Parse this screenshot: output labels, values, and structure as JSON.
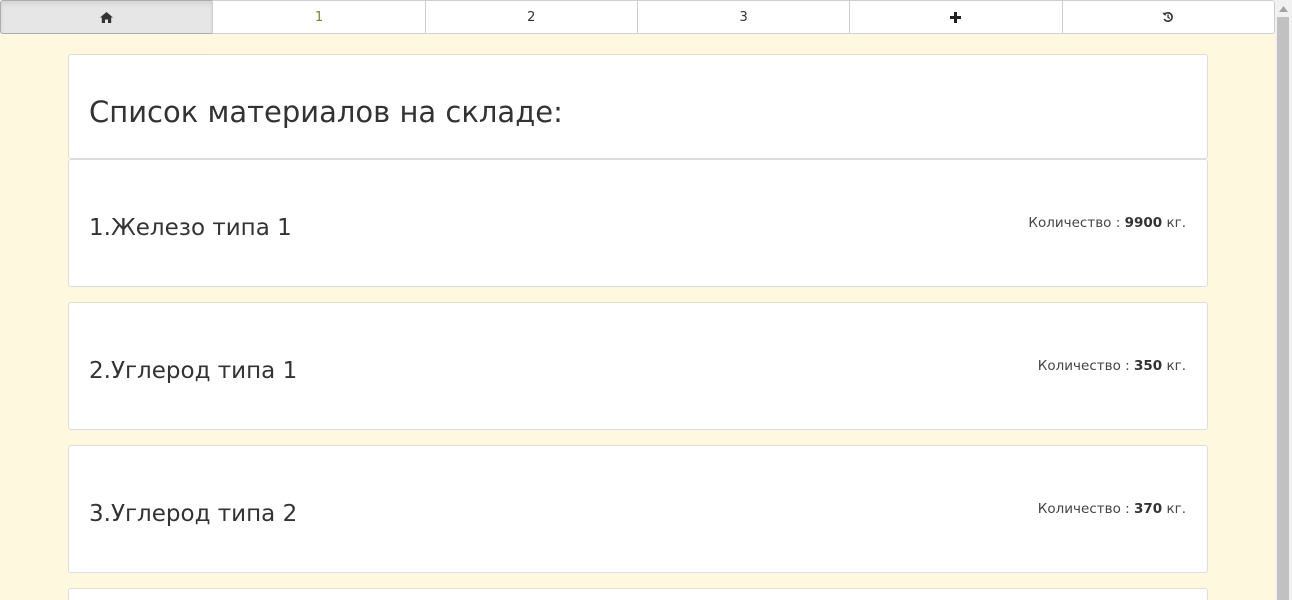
{
  "nav": {
    "buttons": [
      {
        "icon": "home-icon",
        "label": ""
      },
      {
        "label": "1"
      },
      {
        "label": "2"
      },
      {
        "label": "3"
      },
      {
        "icon": "plus-icon",
        "label": ""
      },
      {
        "icon": "history-icon",
        "label": ""
      }
    ]
  },
  "page": {
    "title": "Список материалов на складе:"
  },
  "qty_prefix": "Количество :",
  "qty_unit": "кг.",
  "materials": [
    {
      "name": "1.Железо типа 1",
      "quantity": "9900"
    },
    {
      "name": "2.Углерод типа 1",
      "quantity": "350"
    },
    {
      "name": "3.Углерод типа 2",
      "quantity": "370"
    }
  ],
  "colors": {
    "background": "#fdf8de",
    "panel": "#ffffff",
    "active_page_text": "#6b8e23"
  }
}
